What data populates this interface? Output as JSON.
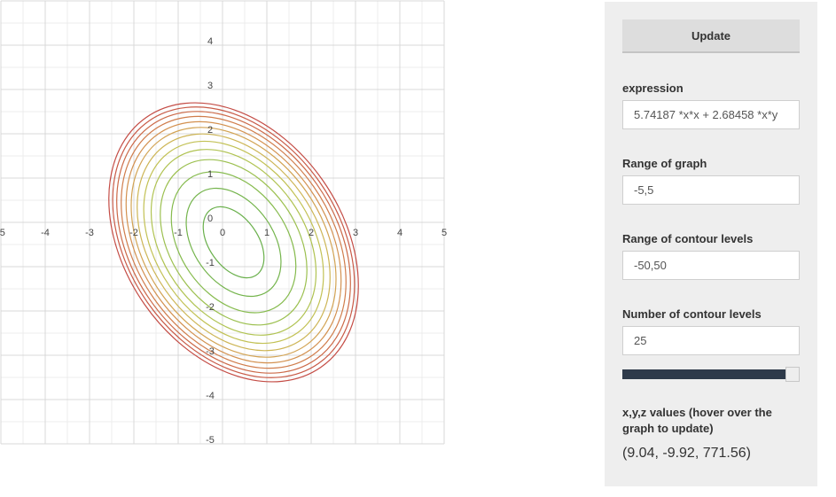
{
  "chart_data": {
    "type": "contour",
    "xlim": [
      -5,
      5
    ],
    "ylim": [
      -5,
      5
    ],
    "x_ticks": [
      "-5",
      "-4",
      "-3",
      "-2",
      "-1",
      "0",
      "1",
      "2",
      "3",
      "4",
      "5"
    ],
    "y_ticks": [
      "-5",
      "-4",
      "-3",
      "-2",
      "-1",
      "0",
      "1",
      "2",
      "3",
      "4"
    ],
    "grid": true,
    "contours": [
      {
        "rx": 0.9,
        "ry": 0.55,
        "color": "#6ab04c"
      },
      {
        "rx": 1.35,
        "ry": 0.9,
        "color": "#74b44c"
      },
      {
        "rx": 1.75,
        "ry": 1.2,
        "color": "#86bb4e"
      },
      {
        "rx": 2.05,
        "ry": 1.42,
        "color": "#9cc050"
      },
      {
        "rx": 2.3,
        "ry": 1.6,
        "color": "#b0c352"
      },
      {
        "rx": 2.5,
        "ry": 1.75,
        "color": "#c2c154"
      },
      {
        "rx": 2.68,
        "ry": 1.88,
        "color": "#cdb555"
      },
      {
        "rx": 2.84,
        "ry": 2.0,
        "color": "#d2a353"
      },
      {
        "rx": 2.98,
        "ry": 2.1,
        "color": "#d39150"
      },
      {
        "rx": 3.11,
        "ry": 2.2,
        "color": "#d07d4c"
      },
      {
        "rx": 3.23,
        "ry": 2.29,
        "color": "#cc6a49"
      },
      {
        "rx": 3.34,
        "ry": 2.37,
        "color": "#c85a47"
      },
      {
        "rx": 3.44,
        "ry": 2.45,
        "color": "#c44c45"
      }
    ],
    "rotation_deg": 55,
    "center": [
      0.25,
      -0.45
    ]
  },
  "panel": {
    "update_label": "Update",
    "expression_label": "expression",
    "expression_value": "5.74187 *x*x + 2.68458 *x*y",
    "range_graph_label": "Range of graph",
    "range_graph_value": "-5,5",
    "range_levels_label": "Range of contour levels",
    "range_levels_value": "-50,50",
    "num_levels_label": "Number of contour levels",
    "num_levels_value": "25",
    "slider_fraction": 0.96,
    "xyz_label": "x,y,z values (hover over the graph to update)",
    "xyz_value": "(9.04, -9.92, 771.56)"
  }
}
